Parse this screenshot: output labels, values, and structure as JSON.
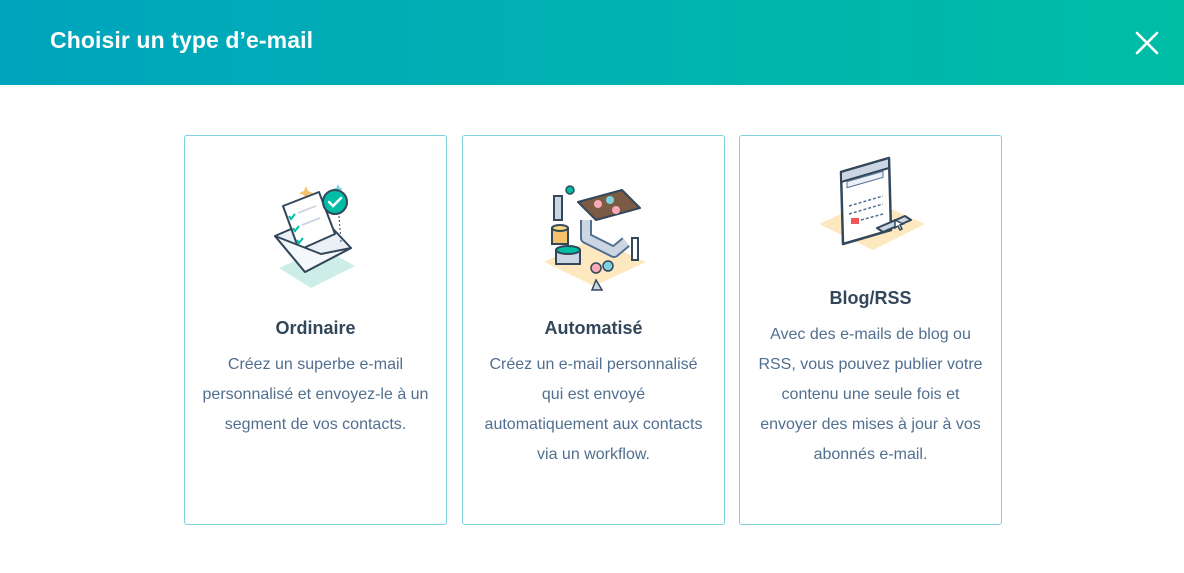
{
  "dialog": {
    "title": "Choisir un type d’e-mail",
    "close_icon": "close-icon"
  },
  "cards": [
    {
      "title": "Ordinaire",
      "description": "Créez un superbe e-mail personnalisé et envoyez-le à un segment de vos contacts.",
      "icon": "envelope-checklist-illustration"
    },
    {
      "title": "Automatisé",
      "description": "Créez un e-mail personnalisé qui est envoyé automatiquement aux contacts via un workflow.",
      "icon": "automation-machine-illustration"
    },
    {
      "title": "Blog/RSS",
      "description": "Avec des e-mails de blog ou RSS, vous pouvez publier votre contenu une seule fois et envoyer des mises à jour à vos abonnés e-mail.",
      "icon": "browser-window-illustration"
    }
  ],
  "colors": {
    "header_gradient_start": "#00a4bd",
    "header_gradient_end": "#00bda5",
    "card_border": "#7fd1de",
    "title_text": "#33475b",
    "body_text": "#516f90"
  }
}
